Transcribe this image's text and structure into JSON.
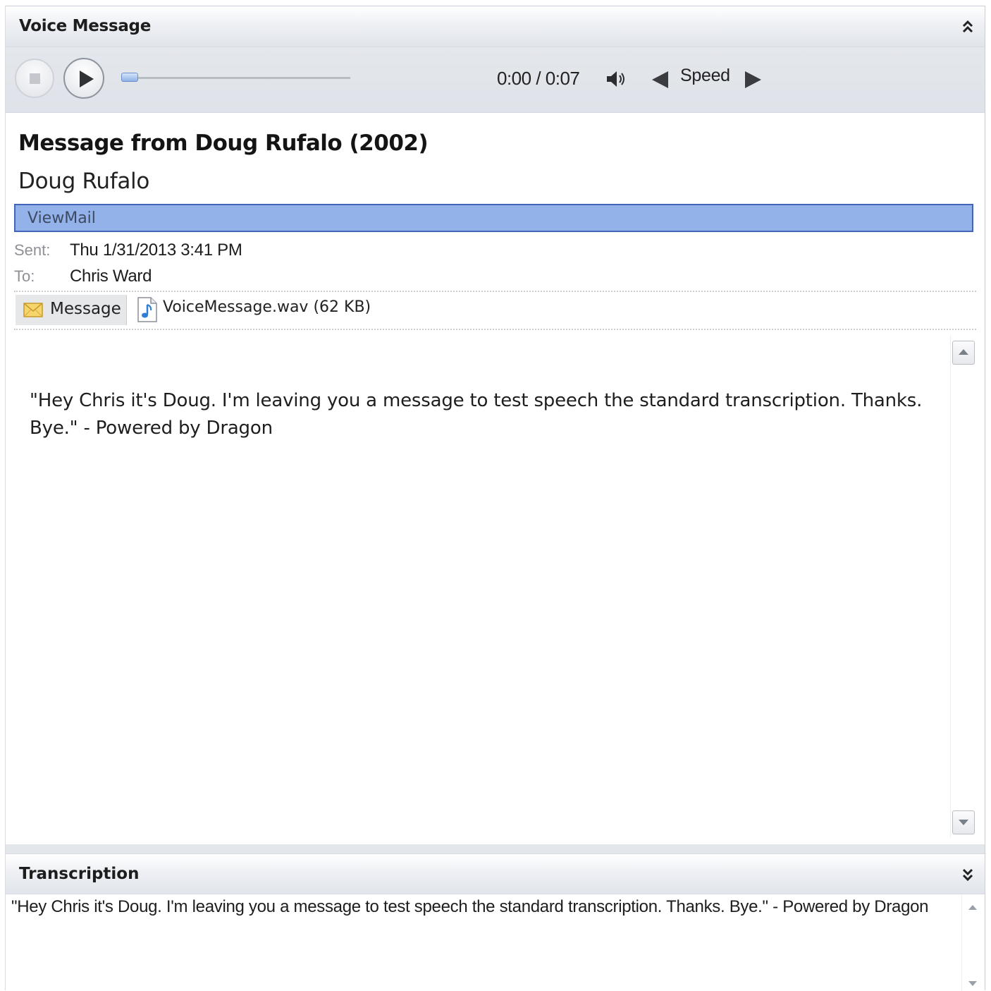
{
  "voice_panel": {
    "title": "Voice Message",
    "collapse_icon": "double-chevron-up-icon"
  },
  "player": {
    "stop_icon": "stop-icon",
    "play_icon": "play-icon",
    "progress": 0,
    "time": "0:00 / 0:07",
    "volume_icon": "speaker-icon",
    "speed_label": "Speed",
    "speed_down_icon": "triangle-left-icon",
    "speed_up_icon": "triangle-right-icon"
  },
  "message": {
    "subject": "Message from Doug Rufalo (2002)",
    "sender": "Doug Rufalo",
    "infobar": "ViewMail",
    "sent_label": "Sent:",
    "sent_value": "Thu 1/31/2013 3:41 PM",
    "to_label": "To:",
    "to_value": "Chris Ward",
    "attachments": {
      "message_tab": "Message",
      "file": "VoiceMessage.wav (62 KB)"
    },
    "body": "\"Hey Chris it's Doug. I'm leaving you a message to test speech the standard transcription. Thanks. Bye.\" - Powered by Dragon"
  },
  "transcription_panel": {
    "title": "Transcription",
    "expand_icon": "double-chevron-down-icon",
    "text": "\"Hey Chris it's Doug. I'm leaving you a message to test speech the standard transcription. Thanks. Bye.\" - Powered by Dragon"
  },
  "colors": {
    "infobar_bg": "#94b2ea",
    "infobar_border": "#4265b7"
  }
}
